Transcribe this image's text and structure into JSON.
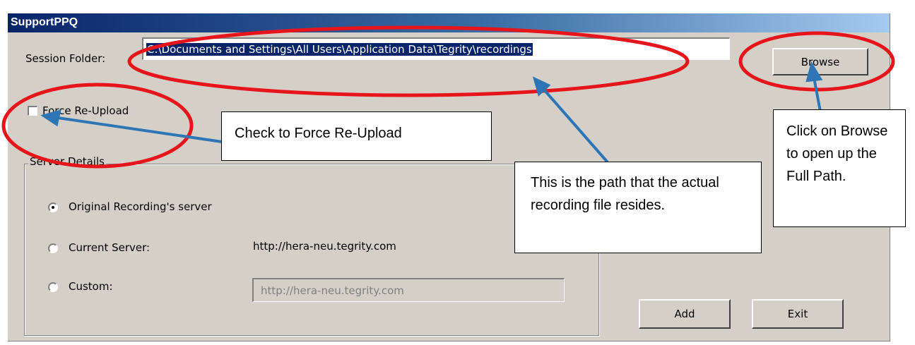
{
  "window": {
    "title": "SupportPPQ"
  },
  "session_folder": {
    "label": "Session Folder:",
    "value": "C:\\Documents and Settings\\All Users\\Application Data\\Tegrity\\recordings",
    "browse_label": "Browse"
  },
  "force_reupload": {
    "label": "Force Re-Upload",
    "checked": false
  },
  "server_details": {
    "legend": "Server Details",
    "options": [
      {
        "label": "Original Recording's server",
        "selected": true
      },
      {
        "label": "Current Server:",
        "value": "http://hera-neu.tegrity.com",
        "selected": false
      },
      {
        "label": "Custom:",
        "placeholder": "http://hera-neu.tegrity.com",
        "selected": false
      }
    ]
  },
  "buttons": {
    "add": "Add",
    "exit": "Exit"
  },
  "callouts": {
    "force_reupload": "Check to Force Re-Upload",
    "path": "This is the path that the actual recording file resides.",
    "browse": "Click on Browse to open up the Full Path."
  },
  "colors": {
    "annotation_ellipse": "#e8141b",
    "annotation_arrow": "#2e75b6",
    "selection": "#0a246a"
  }
}
